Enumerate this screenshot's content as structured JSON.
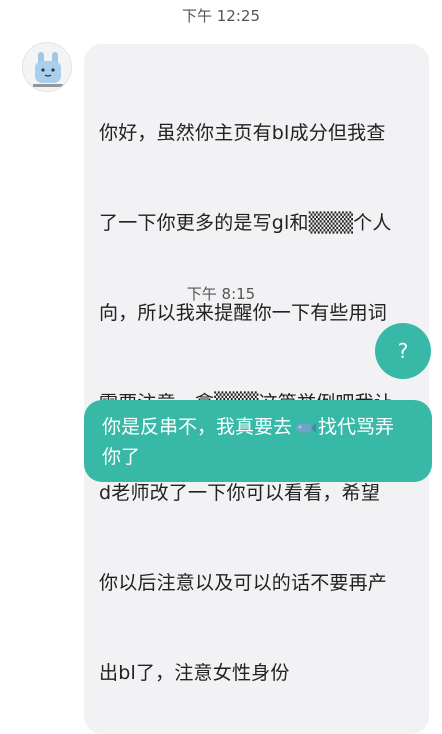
{
  "chat": {
    "timestamp_1": "下午 12:25",
    "timestamp_2": "下午 8:15",
    "incoming": {
      "avatar_icon": "bunny-sticker-avatar-icon",
      "lines": [
        "你好，虽然你主页有bl成分但我查",
        "了一下你更多的是写gl和▒▒▒个人",
        "向，所以我来提醒你一下有些用词",
        "需要注意，拿▒▒▒这篇举例吧我让",
        "d老师改了一下你可以看看，希望",
        "你以后注意以及可以的话不要再产",
        "出bl了，注意女性身份"
      ]
    },
    "outgoing_short": "?",
    "outgoing_long": {
      "part1": "你是反串不，我真要去",
      "emoji": "fish-emoji",
      "part2": "找代骂弄",
      "line2": "你了"
    },
    "colors": {
      "incoming_bubble": "#f2f2f4",
      "outgoing_bubble": "#38b9a8"
    }
  }
}
